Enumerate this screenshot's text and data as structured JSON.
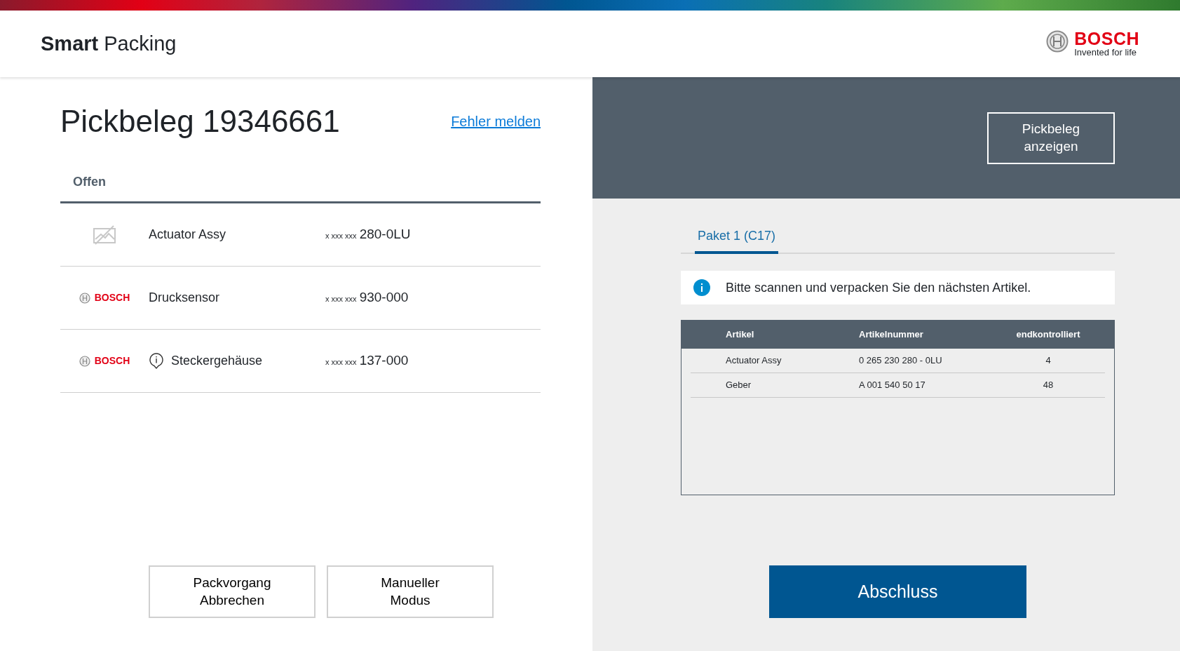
{
  "header": {
    "app_bold": "Smart",
    "app_rest": "Packing",
    "logo_word": "BOSCH",
    "tagline": "Invented for life"
  },
  "left": {
    "title": "Pickbeleg 19346661",
    "report_link": "Fehler melden",
    "tabs": [
      {
        "label": "Offen",
        "selected": true
      }
    ],
    "rows": [
      {
        "kind": "no-image",
        "name": "Actuator Assy",
        "info": false,
        "prefix": "x xxx xxx",
        "number": "280-0LU"
      },
      {
        "kind": "brand",
        "brand": "BOSCH",
        "name": "Drucksensor",
        "info": false,
        "prefix": "x xxx xxx",
        "number": "930-000"
      },
      {
        "kind": "brand",
        "brand": "BOSCH",
        "name": "Steckergehäuse",
        "info": true,
        "prefix": "x xxx xxx",
        "number": "137-000"
      }
    ],
    "buttons": [
      "Packvorgang Abbrechen",
      "Manueller Modus"
    ]
  },
  "right": {
    "show_button": "Pickbeleg anzeigen",
    "tabs": [
      {
        "label": "Paket 1 (C17)",
        "selected": true
      }
    ],
    "notice": "Bitte scannen und verpacken Sie den nächsten Artikel.",
    "table": {
      "columns": [
        "Artikel",
        "Artikelnummer",
        "endkontrolliert"
      ],
      "rows": [
        [
          "Actuator Assy",
          "0 265 230 280 -  0LU",
          "4"
        ],
        [
          "Geber",
          "A 001 540 50 17",
          "48"
        ]
      ]
    },
    "finish_button": "Abschluss"
  }
}
